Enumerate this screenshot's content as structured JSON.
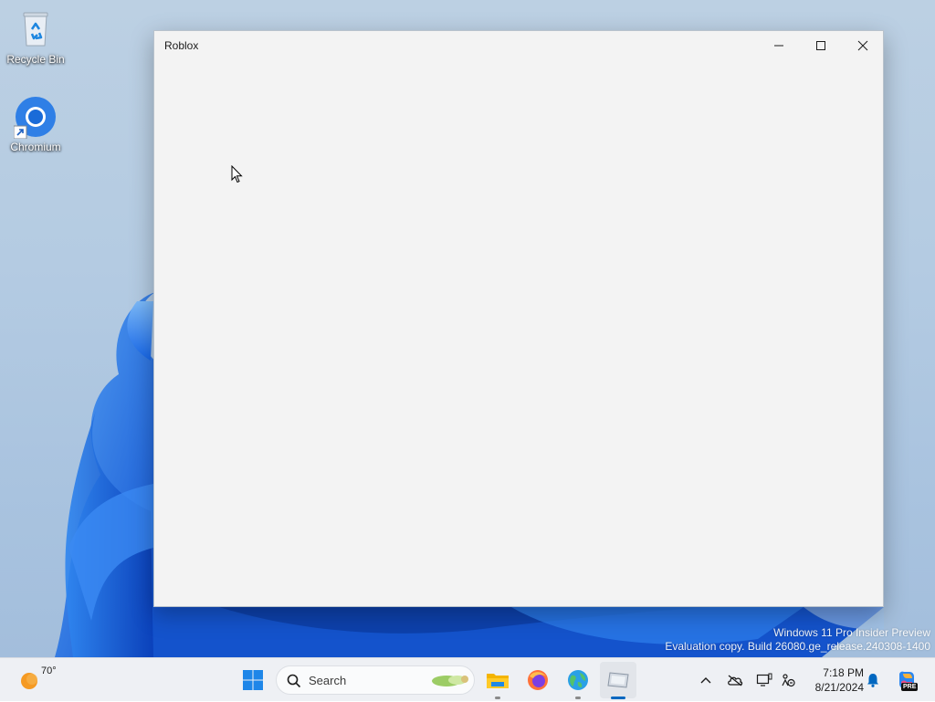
{
  "desktop": {
    "icons": [
      {
        "label": "Recycle Bin",
        "icon": "recycle-bin-icon"
      },
      {
        "label": "Chromium",
        "icon": "chromium-icon"
      }
    ],
    "watermark": {
      "line1": "Windows 11 Pro Insider Preview",
      "line2": "Evaluation copy. Build 26080.ge_release.240308-1400"
    }
  },
  "window": {
    "title": "Roblox",
    "controls": {
      "minimize": "minimize-icon",
      "maximize": "maximize-icon",
      "close": "close-icon"
    },
    "background": "#f3f3f3"
  },
  "taskbar": {
    "weather": {
      "temp": "70°",
      "icon": "sun-icon"
    },
    "search": {
      "placeholder": "Search"
    },
    "apps": [
      {
        "name": "start",
        "icon": "windows-logo-icon"
      },
      {
        "name": "file-explorer",
        "icon": "folder-icon",
        "running": true
      },
      {
        "name": "firefox",
        "icon": "firefox-icon"
      },
      {
        "name": "edge-beta",
        "icon": "globe-icon",
        "running": true
      },
      {
        "name": "roblox",
        "icon": "roblox-app-icon",
        "active": true
      }
    ],
    "tray": {
      "icons": [
        "chevron-up-icon",
        "onedrive-icon",
        "display-icon",
        "accessibility-icon"
      ],
      "time": "7:18 PM",
      "date": "8/21/2024",
      "notification_icon": "bell-icon",
      "copilot_icon": "copilot-icon",
      "copilot_badge": "PRE"
    }
  },
  "colors": {
    "accent": "#0067c0",
    "wallpaper_blue": "#1565e0"
  }
}
